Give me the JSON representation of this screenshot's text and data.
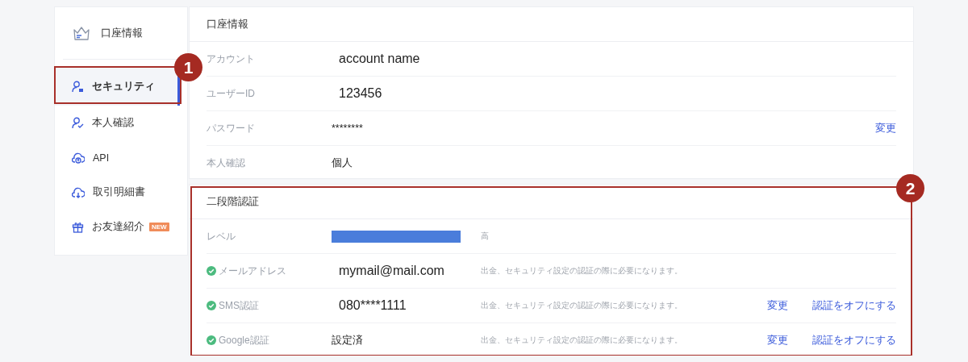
{
  "sidebar": {
    "header": {
      "label": "口座情報"
    },
    "items": [
      {
        "label": "セキュリティ",
        "selected": true
      },
      {
        "label": "本人確認",
        "selected": false
      },
      {
        "label": "API",
        "selected": false
      },
      {
        "label": "取引明細書",
        "selected": false
      },
      {
        "label": "お友達紹介",
        "selected": false,
        "badge": "NEW"
      }
    ]
  },
  "account": {
    "title": "口座情報",
    "rows": [
      {
        "kind": "large",
        "label": "アカウント",
        "value": "account name"
      },
      {
        "kind": "large",
        "label": "ユーザーID",
        "value": "123456"
      },
      {
        "kind": "plain",
        "label": "パスワード",
        "value": "********",
        "actions": [
          "変更"
        ]
      },
      {
        "kind": "plain",
        "label": "本人確認",
        "value": "個人"
      }
    ]
  },
  "two_factor": {
    "title": "二段階認証",
    "level_row": {
      "label": "レベル",
      "level": 1,
      "reading": "高"
    },
    "rows": [
      {
        "kind": "large",
        "label": "メールアドレス",
        "verified": true,
        "value": "mymail@mail.com",
        "note": "出金、セキュリティ設定の認証の際に必要になります。"
      },
      {
        "kind": "large",
        "label": "SMS認証",
        "verified": true,
        "value": "080****1111",
        "note": "出金、セキュリティ設定の認証の際に必要になります。",
        "actions": [
          "変更",
          "認証をオフにする"
        ]
      },
      {
        "kind": "plain",
        "label": "Google認証",
        "verified": true,
        "value": "設定済",
        "note": "出金、セキュリティ設定の認証の際に必要になります。",
        "actions": [
          "変更",
          "認証をオフにする"
        ]
      }
    ]
  },
  "annotations": [
    {
      "label": "1"
    },
    {
      "label": "2"
    }
  ]
}
